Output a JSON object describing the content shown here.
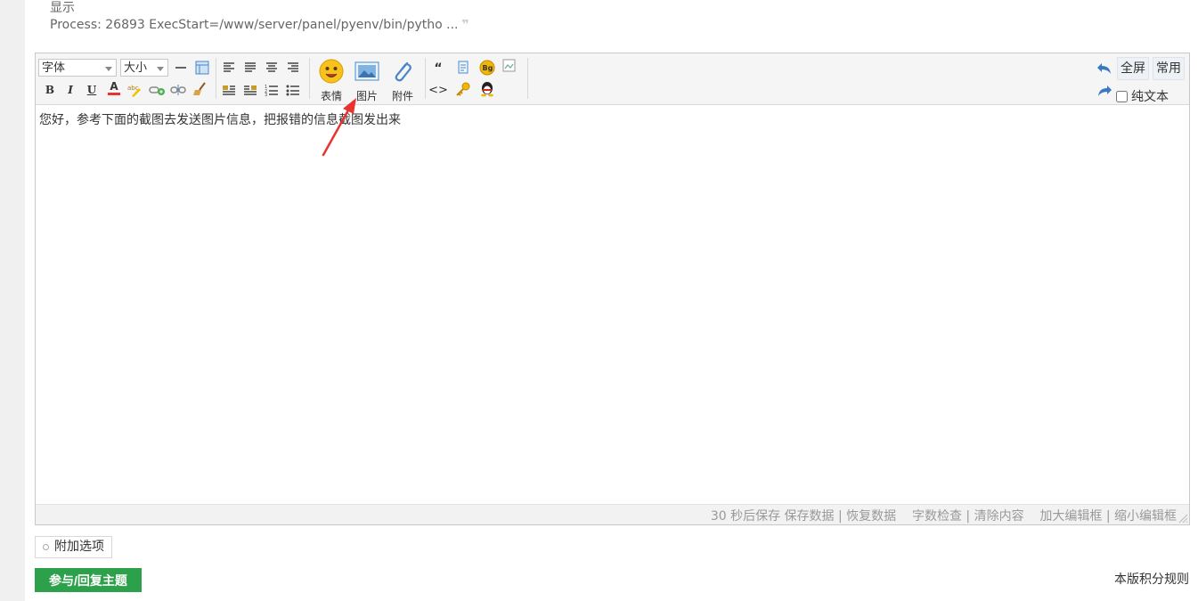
{
  "quote": {
    "line1": "显示",
    "line2": "Process: 26893 ExecStart=/www/server/panel/pyenv/bin/pytho ...",
    "mark": "❞"
  },
  "toolbar": {
    "font_select": "字体",
    "size_select": "大小",
    "bold": "B",
    "italic": "I",
    "underline": "U",
    "font_color": "A",
    "emoticon_label": "表情",
    "image_label": "图片",
    "attachment_label": "附件",
    "quote_glyph": "“",
    "code_glyph": "<>",
    "fullscreen": "全屏",
    "common": "常用",
    "plaintext": "纯文本"
  },
  "editor": {
    "content": "您好，参考下面的截图去发送图片信息，把报错的信息截图发出来"
  },
  "status": {
    "text": "30 秒后保存 保存数据 | 恢复数据    字数检查 | 清除内容    加大编辑框 | 缩小编辑框"
  },
  "footer": {
    "additional_options": "附加选项",
    "submit": "参与/回复主题",
    "rules": "本版积分规则"
  },
  "colors": {
    "submit_bg": "#2ca04a",
    "annotation_arrow": "#e8332e",
    "toolbar_bg": "#f5f5f5"
  }
}
